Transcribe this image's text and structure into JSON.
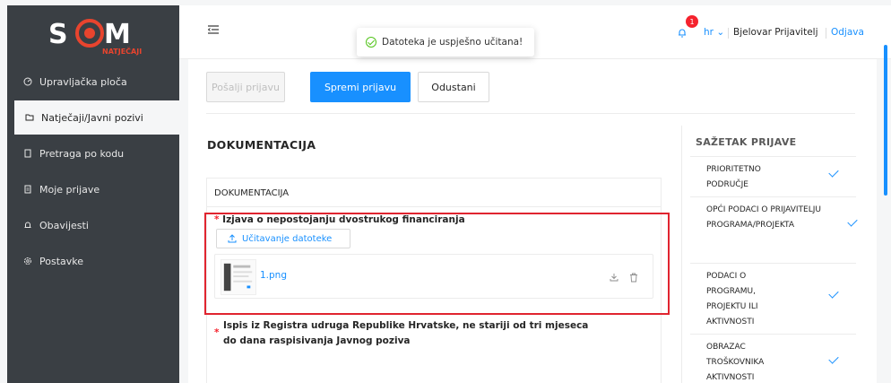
{
  "brand": {
    "logo_text": "SOM",
    "logo_sub": "NATJEČAJI",
    "accent": "#e8442e"
  },
  "sidebar": {
    "items": [
      {
        "label": "Upravljačka ploča",
        "icon": "dashboard-icon"
      },
      {
        "label": "Natječaji/Javni pozivi",
        "icon": "folder-icon",
        "active": true
      },
      {
        "label": "Pretraga po kodu",
        "icon": "file-icon"
      },
      {
        "label": "Moje prijave",
        "icon": "document-icon"
      },
      {
        "label": "Obavijesti",
        "icon": "bell-icon"
      },
      {
        "label": "Postavke",
        "icon": "gear-icon"
      }
    ]
  },
  "topbar": {
    "toast": "Datoteka je uspješno učitana!",
    "notification_count": "1",
    "language": "hr",
    "user": "Bjelovar Prijavitelj",
    "logout": "Odjava"
  },
  "toolbar": {
    "send_label": "Pošalji prijavu",
    "save_label": "Spremi prijavu",
    "cancel_label": "Odustani"
  },
  "section": {
    "title": "DOKUMENTACIJA",
    "box_title": "DOKUMENTACIJA",
    "required_mark": "*",
    "q1_label": "Izjava o nepostojanju dvostrukog financiranja",
    "upload_label": "Učitavanje datoteke",
    "file_name": "1.png",
    "q2_label": "Ispis iz Registra udruga Republike Hrvatske, ne stariji od tri mjeseca do dana raspisivanja Javnog poziva"
  },
  "summary": {
    "title": "SAŽETAK PRIJAVE",
    "items": [
      {
        "label": "PRIORITETNO PODRUČJE",
        "done": true
      },
      {
        "label": "OPĆI PODACI O PRIJAVITELJU PROGRAMA/PROJEKTA",
        "done": true
      },
      {
        "label": "PODACI O PROGRAMU, PROJEKTU ILI AKTIVNOSTI",
        "done": true
      },
      {
        "label": "OBRAZAC TROŠKOVNIKA AKTIVNOSTI",
        "done": true
      }
    ]
  },
  "colors": {
    "primary": "#1890ff",
    "sidebar_bg": "#3a3f44",
    "highlight": "#e0242f",
    "success": "#52c41a"
  }
}
